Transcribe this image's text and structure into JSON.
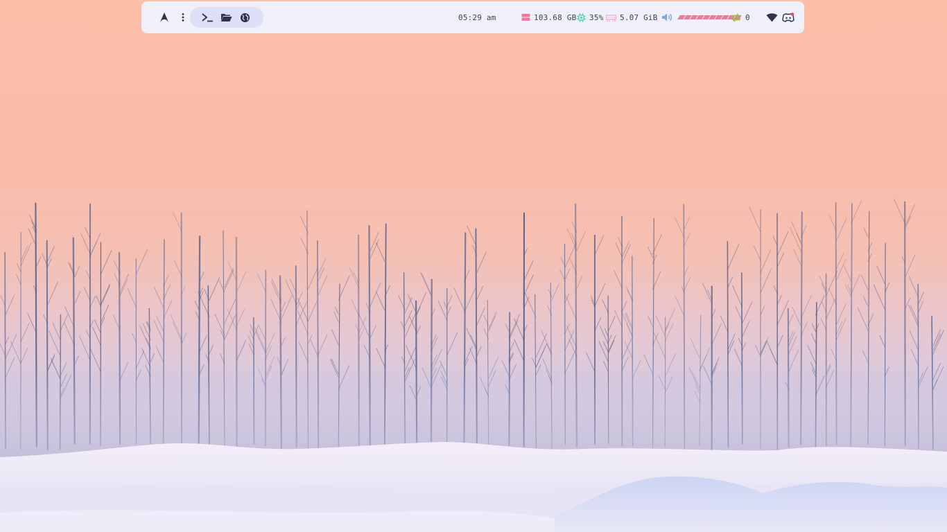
{
  "wallpaper": {
    "description_icon": "winter-trees-snow-wallpaper"
  },
  "topbar": {
    "arch_icon": "arch-logo-icon",
    "menu_icon": "kebab-menu-icon",
    "launchers": [
      {
        "icon": "terminal-icon"
      },
      {
        "icon": "folder-icon"
      },
      {
        "icon": "globe-icon"
      }
    ],
    "clock": "05:29 am",
    "disk": {
      "icon": "disk-icon",
      "value": "103.68 GB",
      "color": "#ec7a9b"
    },
    "cpu": {
      "icon": "cpu-icon",
      "value": "35%",
      "color": "#4fd1b6"
    },
    "memory": {
      "icon": "memory-icon",
      "value": "5.07 GiB",
      "color": "#f2a9d8"
    },
    "volume": {
      "icon": "volume-icon",
      "level": 1.0,
      "segments": 10,
      "color": "#ec7a9b"
    },
    "updates": {
      "icon": "updates-icon",
      "value": "0",
      "color": "#9bc53d"
    },
    "wifi_icon": "wifi-icon",
    "discord_icon": "discord-icon"
  }
}
